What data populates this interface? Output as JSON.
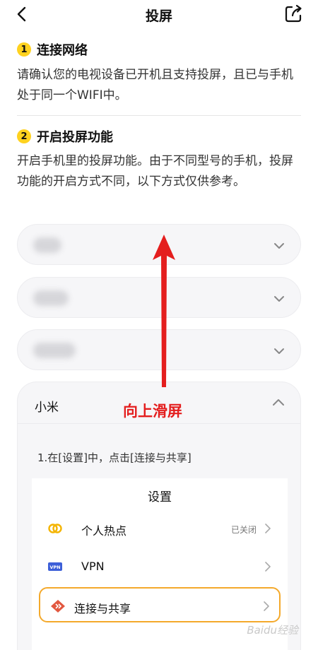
{
  "header": {
    "title": "投屏",
    "back_icon": "back-arrow-icon",
    "share_icon": "share-icon"
  },
  "step1": {
    "number": "1",
    "title": "连接网络",
    "text": "请确认您的电视设备已开机且支持投屏，且已与手机处于同一个WIFI中。"
  },
  "step2": {
    "number": "2",
    "title": "开启投屏功能",
    "text": "开启手机里的投屏功能。由于不同型号的手机，投屏功能的开启方式不同，以下方式仅供参考。"
  },
  "brands": {
    "collapsed_icon": "chevron-down-icon"
  },
  "xiaomi": {
    "title": "小米",
    "expanded_icon": "chevron-up-icon",
    "instruction": "1.在[设置]中，点击[连接与共享]",
    "settings": {
      "title": "设置",
      "rows": [
        {
          "label": "个人热点",
          "status": "已关闭",
          "icon": "hotspot-icon"
        },
        {
          "label": "VPN",
          "status": "",
          "icon": "vpn-icon"
        },
        {
          "label": "连接与共享",
          "status": "",
          "icon": "connection-share-icon"
        }
      ]
    }
  },
  "annotation": {
    "text": "向上滑屏"
  },
  "colors": {
    "step_badge": "#ffd21f",
    "annotation_red": "#e41e1e",
    "highlight_orange": "#f4a92b"
  },
  "watermark": "Baidu经验"
}
